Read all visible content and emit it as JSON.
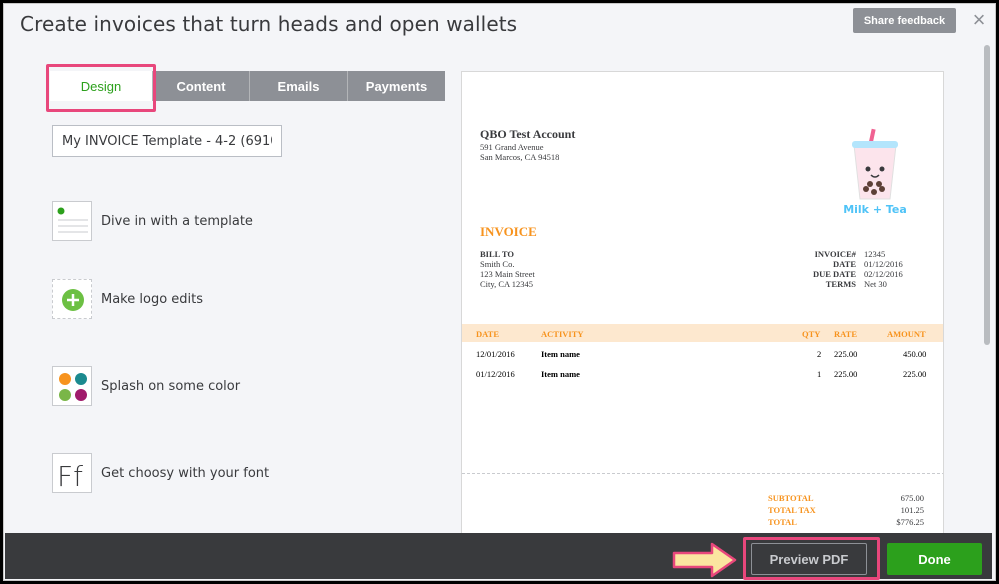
{
  "header": {
    "title": "Create invoices that turn heads and open wallets",
    "share_feedback": "Share feedback",
    "close": "×"
  },
  "tabs": [
    {
      "label": "Design",
      "active": true
    },
    {
      "label": "Content",
      "active": false
    },
    {
      "label": "Emails",
      "active": false
    },
    {
      "label": "Payments",
      "active": false
    }
  ],
  "template_name": "My INVOICE Template - 4-2 (6910)",
  "options": [
    {
      "label": "Dive in with a template",
      "icon": "template-icon"
    },
    {
      "label": "Make logo edits",
      "icon": "add-logo-icon"
    },
    {
      "label": "Splash on some color",
      "icon": "color-palette-icon"
    },
    {
      "label": "Get choosy with your font",
      "icon": "font-icon"
    }
  ],
  "invoice": {
    "company": "QBO Test Account",
    "address1": "591 Grand Avenue",
    "address2": "San Marcos, CA 94518",
    "logo_text": "Milk + Tea",
    "heading": "INVOICE",
    "bill_to_label": "BILL TO",
    "bill_to_lines": [
      "Smith Co.",
      "123 Main Street",
      "City, CA 12345"
    ],
    "meta_labels": [
      "INVOICE#",
      "DATE",
      "DUE DATE",
      "TERMS"
    ],
    "meta_values": [
      "12345",
      "01/12/2016",
      "02/12/2016",
      "Net 30"
    ],
    "columns": [
      "DATE",
      "ACTIVITY",
      "QTY",
      "RATE",
      "AMOUNT"
    ],
    "rows": [
      {
        "date": "12/01/2016",
        "activity": "Item name",
        "qty": "2",
        "rate": "225.00",
        "amount": "450.00"
      },
      {
        "date": "01/12/2016",
        "activity": "Item name",
        "qty": "1",
        "rate": "225.00",
        "amount": "225.00"
      }
    ],
    "totals_labels": [
      "SUBTOTAL",
      "TOTAL TAX",
      "TOTAL"
    ],
    "totals_values": [
      "675.00",
      "101.25",
      "$776.25"
    ]
  },
  "footer": {
    "preview_pdf": "Preview PDF",
    "done": "Done"
  },
  "colors": {
    "accent_green": "#2ca01c",
    "highlight_pink": "#e8477c",
    "invoice_orange": "#f7931e"
  }
}
